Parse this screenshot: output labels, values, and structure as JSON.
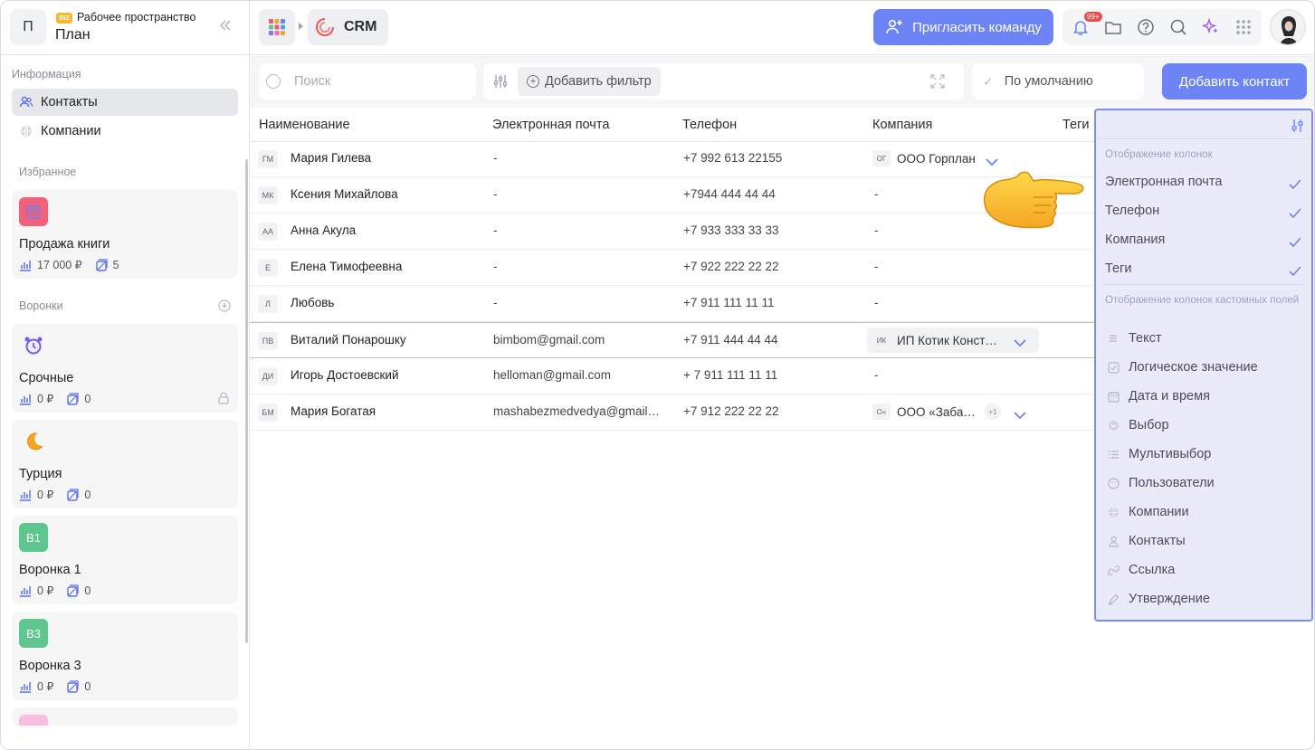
{
  "workspace": {
    "avatar_letter": "П",
    "badge": "BIZ",
    "subtitle": "Рабочее пространство",
    "name": "План"
  },
  "sidebar": {
    "info_label": "Информация",
    "nav": [
      {
        "label": "Контакты",
        "active": true,
        "icon": "users-icon"
      },
      {
        "label": "Компании",
        "active": false,
        "icon": "globe-icon"
      }
    ],
    "favorites_label": "Избранное",
    "favorites": [
      {
        "title": "Продажа книги",
        "icon": "calendar-icon",
        "amount": "17 000 ₽",
        "count": "5"
      }
    ],
    "funnels_label": "Воронки",
    "funnels": [
      {
        "title": "Срочные",
        "icon": "alarm-clock-icon",
        "amount": "0 ₽",
        "count": "0",
        "locked": true
      },
      {
        "title": "Турция",
        "icon": "moon-icon",
        "amount": "0 ₽",
        "count": "0",
        "locked": false
      },
      {
        "title": "Воронка 1",
        "badge": "В1",
        "amount": "0 ₽",
        "count": "0",
        "locked": false
      },
      {
        "title": "Воронка 3",
        "badge": "В3",
        "amount": "0 ₽",
        "count": "0",
        "locked": false
      }
    ]
  },
  "topbar": {
    "crumb": "CRM",
    "invite_label": "Пригласить команду",
    "notifications_badge": "99+"
  },
  "filters": {
    "search_placeholder": "Поиск",
    "add_filter_label": "Добавить фильтр",
    "view_label": "По умолчанию",
    "add_contact_label": "Добавить контакт"
  },
  "table": {
    "headers": [
      "Наименование",
      "Электронная почта",
      "Телефон",
      "Компания",
      "Теги"
    ],
    "rows": [
      {
        "initials": "ГМ",
        "name": "Мария Гилева",
        "email": "-",
        "phone": "+7 992 613 22155",
        "company": "ООО Горплан",
        "company_initials": "ОГ"
      },
      {
        "initials": "МК",
        "name": "Ксения Михайлова",
        "email": "-",
        "phone": "+7944 444 44 44",
        "company": "-"
      },
      {
        "initials": "АА",
        "name": "Анна Акула",
        "email": "-",
        "phone": "+7 933 333 33 33",
        "company": "-"
      },
      {
        "initials": "Е",
        "name": "Елена Тимофеевна",
        "email": "-",
        "phone": "+7 922 222 22 22",
        "company": "-"
      },
      {
        "initials": "Л",
        "name": "Любовь",
        "email": "-",
        "phone": "+7 911 111 11 11",
        "company": "-"
      },
      {
        "initials": "ПВ",
        "name": "Виталий Понарошку",
        "email": "bimbom@gmail.com",
        "phone": "+7 911 444 44 44",
        "company": "ИП Котик Конст…",
        "company_initials": "ИК"
      },
      {
        "initials": "ДИ",
        "name": "Игорь Достоевский",
        "email": "helloman@gmail.com",
        "phone": "+ 7 911 111 11 11",
        "company": "-"
      },
      {
        "initials": "БМ",
        "name": "Мария Богатая",
        "email": "mashabezmedvedya@gmail…",
        "phone": "+7 912 222 22 22",
        "company": "ООО «Заба…",
        "company_initials": "О«",
        "extra": "+1"
      }
    ]
  },
  "columns_panel": {
    "section1": "Отображение колонок",
    "columns": [
      "Электронная почта",
      "Телефон",
      "Компания",
      "Теги"
    ],
    "section2": "Отображение колонок кастомных полей",
    "custom": [
      {
        "label": "Текст",
        "icon": "text-lines-icon"
      },
      {
        "label": "Логическое значение",
        "icon": "checkbox-icon"
      },
      {
        "label": "Дата и время",
        "icon": "calendar-icon"
      },
      {
        "label": "Выбор",
        "icon": "select-icon"
      },
      {
        "label": "Мультивыбор",
        "icon": "list-icon"
      },
      {
        "label": "Пользователи",
        "icon": "user-circle-icon"
      },
      {
        "label": "Компании",
        "icon": "globe-icon"
      },
      {
        "label": "Контакты",
        "icon": "person-icon"
      },
      {
        "label": "Ссылка",
        "icon": "link-icon"
      },
      {
        "label": "Утверждение",
        "icon": "pen-icon"
      }
    ]
  },
  "colors": {
    "accent": "#6c84f6",
    "panel_border": "#7c8ef5",
    "panel_bg": "#e9ebfb",
    "funnel_badge": "#5ec68f"
  }
}
